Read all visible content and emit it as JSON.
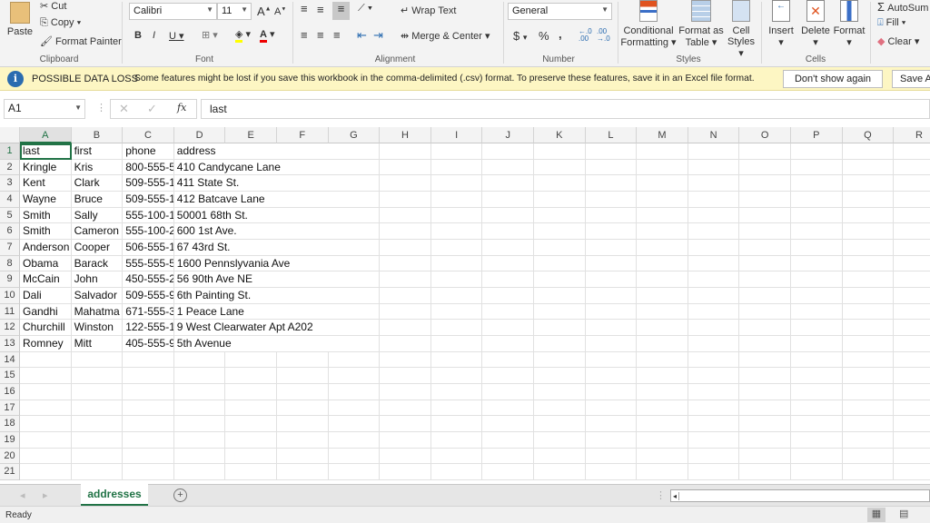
{
  "ribbon": {
    "clipboard": {
      "paste": "Paste",
      "cut": "Cut",
      "copy": "Copy",
      "format_painter": "Format Painter",
      "label": "Clipboard"
    },
    "font": {
      "name": "Calibri",
      "size": "11",
      "bold": "B",
      "italic": "I",
      "underline": "U",
      "label": "Font"
    },
    "alignment": {
      "wrap_text": "Wrap Text",
      "merge_center": "Merge & Center",
      "label": "Alignment"
    },
    "number": {
      "format": "General",
      "currency": "$",
      "percent": "%",
      "comma": ",",
      "label": "Number"
    },
    "styles": {
      "conditional": "Conditional",
      "conditional2": "Formatting",
      "format_table": "Format as",
      "format_table2": "Table",
      "cell_styles": "Cell",
      "cell_styles2": "Styles",
      "label": "Styles"
    },
    "cells": {
      "insert": "Insert",
      "delete": "Delete",
      "format": "Format",
      "label": "Cells"
    },
    "editing": {
      "autosum": "AutoSum",
      "fill": "Fill",
      "clear": "Clear"
    }
  },
  "banner": {
    "title": "POSSIBLE DATA LOSS",
    "message": "Some features might be lost if you save this workbook in the comma-delimited (.csv) format. To preserve these features, save it in an Excel file format.",
    "dont_show": "Don't show again",
    "save_as": "Save As"
  },
  "formula_bar": {
    "name_box": "A1",
    "fx": "fx",
    "value": "last"
  },
  "columns": [
    "A",
    "B",
    "C",
    "D",
    "E",
    "F",
    "G",
    "H",
    "I",
    "J",
    "K",
    "L",
    "M",
    "N",
    "O",
    "P",
    "Q",
    "R"
  ],
  "rows": [
    [
      "last",
      "first",
      "phone",
      "address"
    ],
    [
      "Kringle",
      "Kris",
      "800-555-5",
      "410 Candycane Lane"
    ],
    [
      "Kent",
      "Clark",
      "509-555-1",
      "411 State St."
    ],
    [
      "Wayne",
      "Bruce",
      "509-555-1",
      "412 Batcave Lane"
    ],
    [
      "Smith",
      "Sally",
      "555-100-1",
      "50001 68th St."
    ],
    [
      "Smith",
      "Cameron",
      "555-100-2",
      "600 1st Ave."
    ],
    [
      "Anderson",
      "Cooper",
      "506-555-1",
      "67 43rd St."
    ],
    [
      "Obama",
      "Barack",
      "555-555-5",
      "1600 Pennslyvania Ave"
    ],
    [
      "McCain",
      "John",
      "450-555-2",
      "56 90th Ave NE"
    ],
    [
      "Dali",
      "Salvador",
      "509-555-9",
      "6th Painting St."
    ],
    [
      "Gandhi",
      "Mahatma",
      "671-555-3",
      "1 Peace Lane"
    ],
    [
      "Churchill",
      "Winston",
      "122-555-1",
      "9 West Clearwater Apt A202"
    ],
    [
      "Romney",
      "Mitt",
      "405-555-9",
      "5th Avenue"
    ]
  ],
  "row_count": 21,
  "selected_cell": "A1",
  "sheet_tab": "addresses",
  "status": "Ready",
  "colors": {
    "accent": "#217346",
    "banner": "#fdf6c3",
    "info": "#2b6cb0"
  }
}
